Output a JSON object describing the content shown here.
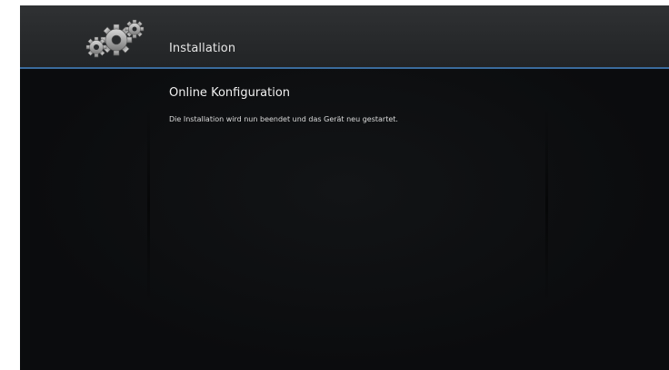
{
  "header": {
    "icon": "gears-icon",
    "title": "Installation"
  },
  "main": {
    "section_title": "Online Konfiguration",
    "message": "Die Installation wird nun beendet und das Gerät neu gestartet."
  },
  "colors": {
    "header_background": "#2b2d2f",
    "header_border": "#3a6b9c",
    "screen_background": "#0b0c0e",
    "text": "#e6e6e6"
  }
}
